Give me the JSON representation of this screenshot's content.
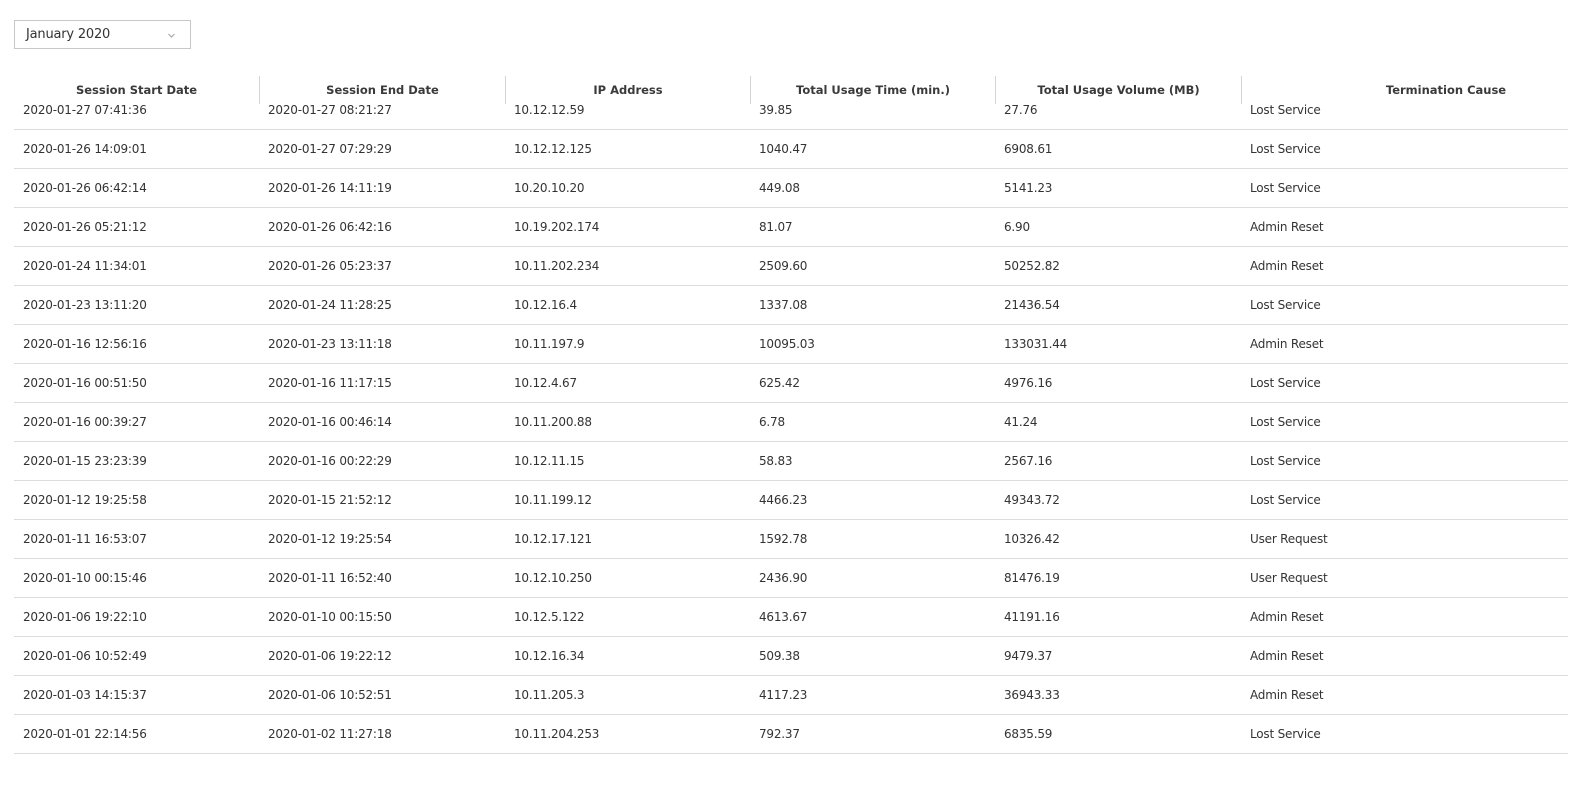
{
  "filter": {
    "month_label": "January 2020"
  },
  "table": {
    "headers": [
      "Session Start Date",
      "Session End Date",
      "IP Address",
      "Total Usage Time (min.)",
      "Total Usage Volume (MB)",
      "Termination Cause"
    ],
    "rows": [
      [
        "2020-01-27 07:41:36",
        "2020-01-27 08:21:27",
        "10.12.12.59",
        "39.85",
        "27.76",
        "Lost Service"
      ],
      [
        "2020-01-26 14:09:01",
        "2020-01-27 07:29:29",
        "10.12.12.125",
        "1040.47",
        "6908.61",
        "Lost Service"
      ],
      [
        "2020-01-26 06:42:14",
        "2020-01-26 14:11:19",
        "10.20.10.20",
        "449.08",
        "5141.23",
        "Lost Service"
      ],
      [
        "2020-01-26 05:21:12",
        "2020-01-26 06:42:16",
        "10.19.202.174",
        "81.07",
        "6.90",
        "Admin Reset"
      ],
      [
        "2020-01-24 11:34:01",
        "2020-01-26 05:23:37",
        "10.11.202.234",
        "2509.60",
        "50252.82",
        "Admin Reset"
      ],
      [
        "2020-01-23 13:11:20",
        "2020-01-24 11:28:25",
        "10.12.16.4",
        "1337.08",
        "21436.54",
        "Lost Service"
      ],
      [
        "2020-01-16 12:56:16",
        "2020-01-23 13:11:18",
        "10.11.197.9",
        "10095.03",
        "133031.44",
        "Admin Reset"
      ],
      [
        "2020-01-16 00:51:50",
        "2020-01-16 11:17:15",
        "10.12.4.67",
        "625.42",
        "4976.16",
        "Lost Service"
      ],
      [
        "2020-01-16 00:39:27",
        "2020-01-16 00:46:14",
        "10.11.200.88",
        "6.78",
        "41.24",
        "Lost Service"
      ],
      [
        "2020-01-15 23:23:39",
        "2020-01-16 00:22:29",
        "10.12.11.15",
        "58.83",
        "2567.16",
        "Lost Service"
      ],
      [
        "2020-01-12 19:25:58",
        "2020-01-15 21:52:12",
        "10.11.199.12",
        "4466.23",
        "49343.72",
        "Lost Service"
      ],
      [
        "2020-01-11 16:53:07",
        "2020-01-12 19:25:54",
        "10.12.17.121",
        "1592.78",
        "10326.42",
        "User Request"
      ],
      [
        "2020-01-10 00:15:46",
        "2020-01-11 16:52:40",
        "10.12.10.250",
        "2436.90",
        "81476.19",
        "User Request"
      ],
      [
        "2020-01-06 19:22:10",
        "2020-01-10 00:15:50",
        "10.12.5.122",
        "4613.67",
        "41191.16",
        "Admin Reset"
      ],
      [
        "2020-01-06 10:52:49",
        "2020-01-06 19:22:12",
        "10.12.16.34",
        "509.38",
        "9479.37",
        "Admin Reset"
      ],
      [
        "2020-01-03 14:15:37",
        "2020-01-06 10:52:51",
        "10.11.205.3",
        "4117.23",
        "36943.33",
        "Admin Reset"
      ],
      [
        "2020-01-01 22:14:56",
        "2020-01-02 11:27:18",
        "10.11.204.253",
        "792.37",
        "6835.59",
        "Lost Service"
      ]
    ]
  }
}
